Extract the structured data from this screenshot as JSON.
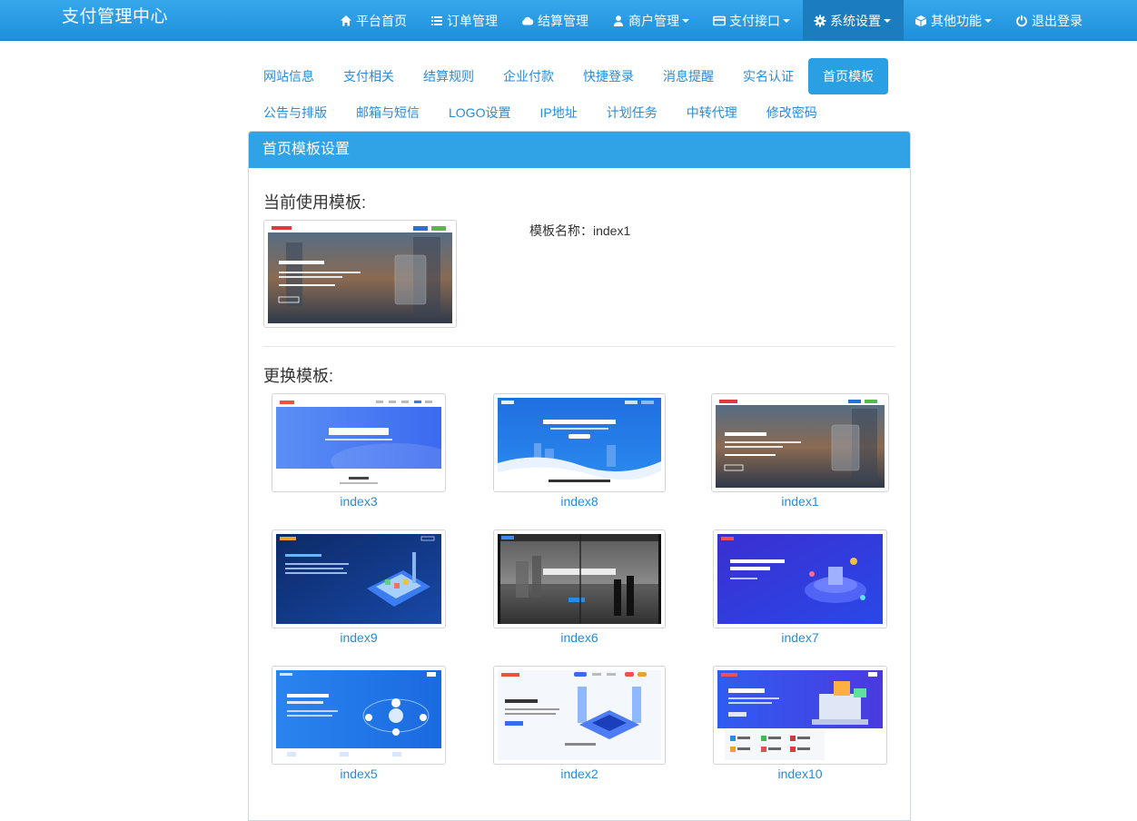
{
  "app": {
    "title": "支付管理中心"
  },
  "nav": [
    {
      "label": "平台首页",
      "icon": "home-icon"
    },
    {
      "label": "订单管理",
      "icon": "list-icon"
    },
    {
      "label": "结算管理",
      "icon": "cloud-icon"
    },
    {
      "label": "商户管理",
      "icon": "user-icon",
      "dropdown": true
    },
    {
      "label": "支付接口",
      "icon": "credit-card-icon",
      "dropdown": true
    },
    {
      "label": "系统设置",
      "icon": "gear-icon",
      "dropdown": true,
      "active": true
    },
    {
      "label": "其他功能",
      "icon": "cube-icon",
      "dropdown": true
    },
    {
      "label": "退出登录",
      "icon": "power-icon"
    }
  ],
  "tabs": {
    "row1": [
      "网站信息",
      "支付相关",
      "结算规则",
      "企业付款",
      "快捷登录",
      "消息提醒",
      "实名认证",
      "首页模板"
    ],
    "row2": [
      "公告与排版",
      "邮箱与短信",
      "LOGO设置",
      "IP地址",
      "计划任务",
      "中转代理",
      "修改密码"
    ],
    "active": "首页模板"
  },
  "panel": {
    "title": "首页模板设置",
    "current_heading": "当前使用模板:",
    "current_name_label": "模板名称：index1",
    "change_heading": "更换模板:"
  },
  "templates": [
    "index3",
    "index8",
    "index1",
    "index9",
    "index6",
    "index7",
    "index5",
    "index2",
    "index10"
  ],
  "colors": {
    "accent": "#2b9fe4",
    "nav_bg": "#1e90dc",
    "link": "#2a8bd4"
  }
}
